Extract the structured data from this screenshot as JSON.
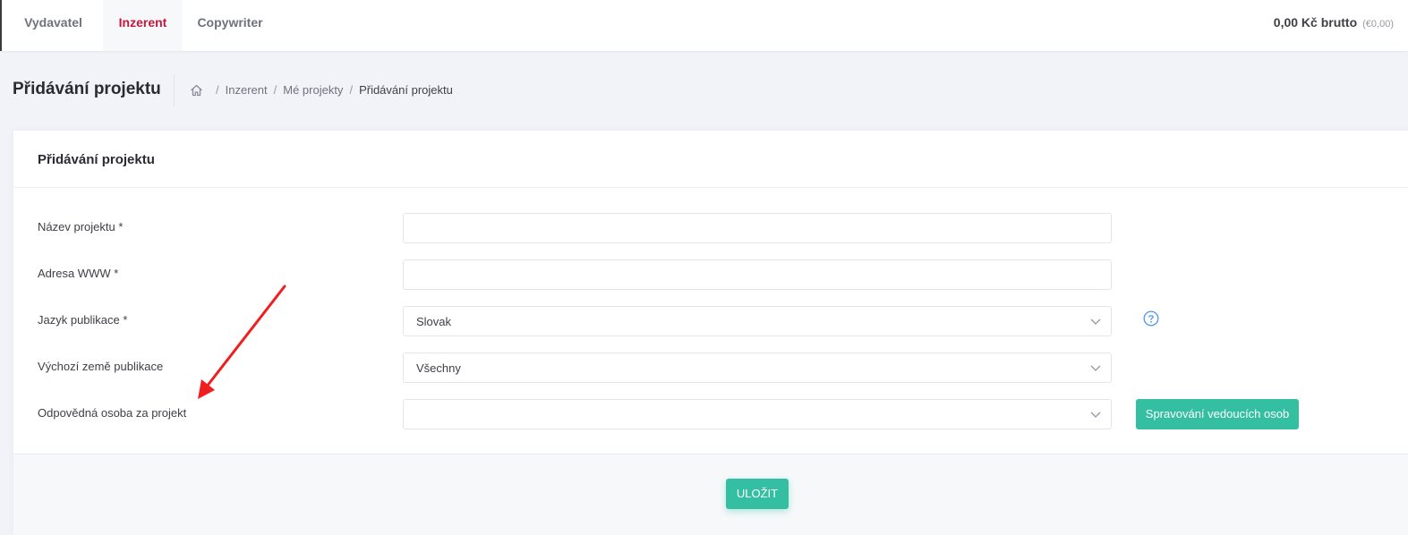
{
  "topnav": {
    "tabs": [
      {
        "label": "Vydavatel"
      },
      {
        "label": "Inzerent"
      },
      {
        "label": "Copywriter"
      }
    ],
    "active_tab": "Inzerent",
    "balance": "0,00 Kč brutto",
    "balance_eur": "(€0,00)"
  },
  "subheader": {
    "title": "Přidávání projektu",
    "breadcrumb": [
      "Inzerent",
      "Mé projekty",
      "Přidávání projektu"
    ]
  },
  "form": {
    "title": "Přidávání projektu",
    "fields": [
      {
        "label": "Název projektu *",
        "value": ""
      },
      {
        "label": "Adresa WWW *",
        "value": ""
      },
      {
        "label": "Jazyk publikace *",
        "value": "Slovak"
      },
      {
        "label": "Výchozí země publikace",
        "value": "Všechny"
      },
      {
        "label": "Odpovědná osoba za projekt",
        "value": ""
      }
    ],
    "manage_button": "Spravování vedoucích osob",
    "save_button": "ULOŽIT"
  },
  "colors": {
    "accent": "#34bfa3",
    "active_tab": "#c4173f",
    "help_icon": "#5d9cec",
    "annotation": "#f01e1e"
  }
}
